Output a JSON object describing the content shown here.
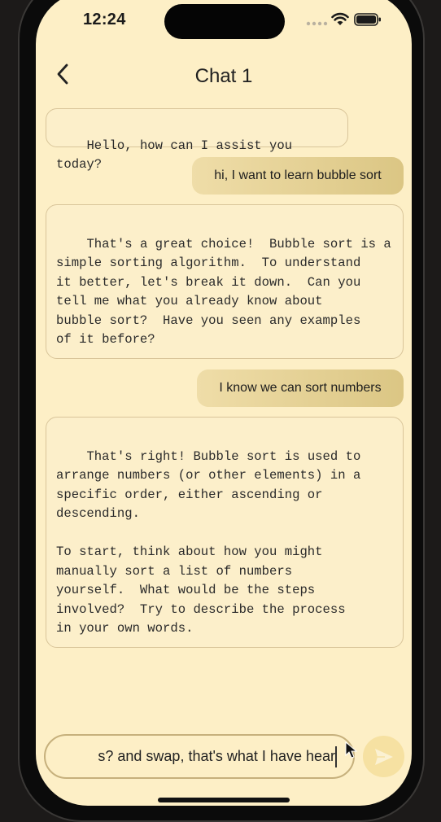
{
  "status_bar": {
    "time": "12:24"
  },
  "header": {
    "title": "Chat 1"
  },
  "messages": [
    {
      "sender": "bot",
      "text": "Hello, how can I assist you today?"
    },
    {
      "sender": "user",
      "text": "hi, I want to learn bubble sort"
    },
    {
      "sender": "bot",
      "text": "That's a great choice!  Bubble sort is a\nsimple sorting algorithm.  To understand\nit better, let's break it down.  Can you\ntell me what you already know about\nbubble sort?  Have you seen any examples\nof it before?"
    },
    {
      "sender": "user",
      "text": "I know we can sort numbers"
    },
    {
      "sender": "bot",
      "text": "That's right! Bubble sort is used to\narrange numbers (or other elements) in a\nspecific order, either ascending or\ndescending.\n\nTo start, think about how you might\nmanually sort a list of numbers\nyourself.  What would be the steps\ninvolved?  Try to describe the process\nin your own words."
    }
  ],
  "composer": {
    "value": "s? and swap, that's what I have hear"
  },
  "icons": {
    "back": "chevron-left-icon",
    "send": "send-icon",
    "signal": "cellular-signal-icon",
    "wifi": "wifi-icon",
    "battery": "battery-icon"
  },
  "colors": {
    "background": "#fdefc6",
    "user_bubble_start": "#efdda8",
    "user_bubble_end": "#dbc684",
    "bot_bubble_border": "#d9c59a",
    "send_button": "#f6e1a2"
  }
}
